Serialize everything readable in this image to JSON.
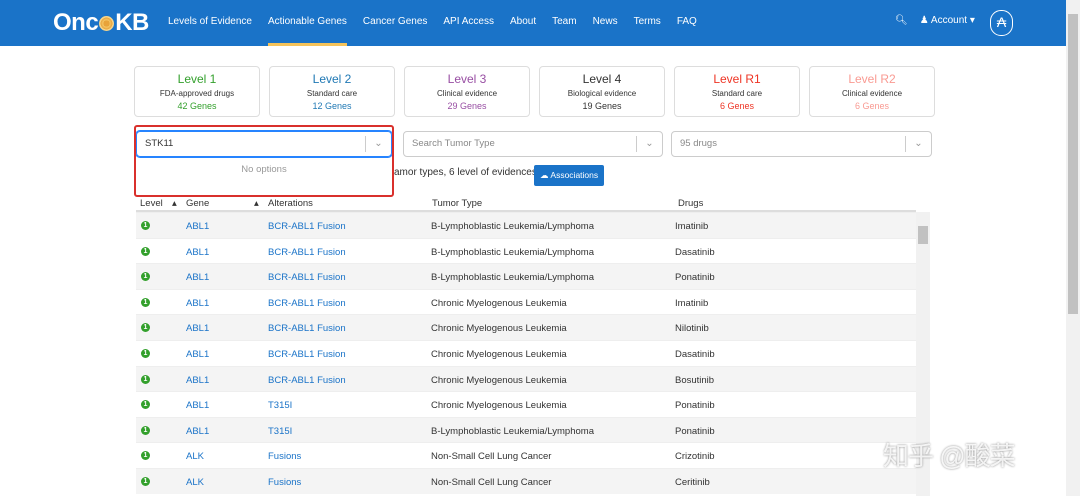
{
  "nav": {
    "logo": "OncoKB",
    "items": [
      "Levels of Evidence",
      "Actionable Genes",
      "Cancer Genes",
      "API Access",
      "About",
      "Team",
      "News",
      "Terms",
      "FAQ"
    ],
    "active": 1,
    "account": "Account"
  },
  "levels": [
    {
      "title": "Level 1",
      "sub": "FDA-approved drugs",
      "count": "42 Genes",
      "color": "#33a02c"
    },
    {
      "title": "Level 2",
      "sub": "Standard care",
      "count": "12 Genes",
      "color": "#1f78b4"
    },
    {
      "title": "Level 3",
      "sub": "Clinical evidence",
      "count": "29 Genes",
      "color": "#984ea3"
    },
    {
      "title": "Level 4",
      "sub": "Biological evidence",
      "count": "19 Genes",
      "color": "#333333"
    },
    {
      "title": "Level R1",
      "sub": "Standard care",
      "count": "6 Genes",
      "color": "#ee3424"
    },
    {
      "title": "Level R2",
      "sub": "Clinical evidence",
      "count": "6 Genes",
      "color": "#f99a92"
    }
  ],
  "filters": {
    "gene_value": "STK11",
    "no_options": "No options",
    "tumor_placeholder": "Search Tumor Type",
    "drugs_placeholder": "95 drugs"
  },
  "summary": "amor types, 6 level of evidences)",
  "associations_button": "Associations",
  "table": {
    "headers": [
      "Level",
      "Gene",
      "Alterations",
      "Tumor Type",
      "Drugs"
    ],
    "rows": [
      [
        "1",
        "ABL1",
        "BCR-ABL1 Fusion",
        "B-Lymphoblastic Leukemia/Lymphoma",
        "Imatinib"
      ],
      [
        "1",
        "ABL1",
        "BCR-ABL1 Fusion",
        "B-Lymphoblastic Leukemia/Lymphoma",
        "Dasatinib"
      ],
      [
        "1",
        "ABL1",
        "BCR-ABL1 Fusion",
        "B-Lymphoblastic Leukemia/Lymphoma",
        "Ponatinib"
      ],
      [
        "1",
        "ABL1",
        "BCR-ABL1 Fusion",
        "Chronic Myelogenous Leukemia",
        "Imatinib"
      ],
      [
        "1",
        "ABL1",
        "BCR-ABL1 Fusion",
        "Chronic Myelogenous Leukemia",
        "Nilotinib"
      ],
      [
        "1",
        "ABL1",
        "BCR-ABL1 Fusion",
        "Chronic Myelogenous Leukemia",
        "Dasatinib"
      ],
      [
        "1",
        "ABL1",
        "BCR-ABL1 Fusion",
        "Chronic Myelogenous Leukemia",
        "Bosutinib"
      ],
      [
        "1",
        "ABL1",
        "T315I",
        "Chronic Myelogenous Leukemia",
        "Ponatinib"
      ],
      [
        "1",
        "ABL1",
        "T315I",
        "B-Lymphoblastic Leukemia/Lymphoma",
        "Ponatinib"
      ],
      [
        "1",
        "ALK",
        "Fusions",
        "Non-Small Cell Lung Cancer",
        "Crizotinib"
      ],
      [
        "1",
        "ALK",
        "Fusions",
        "Non-Small Cell Lung Cancer",
        "Ceritinib"
      ]
    ]
  },
  "watermark": "知乎 @酸菜"
}
